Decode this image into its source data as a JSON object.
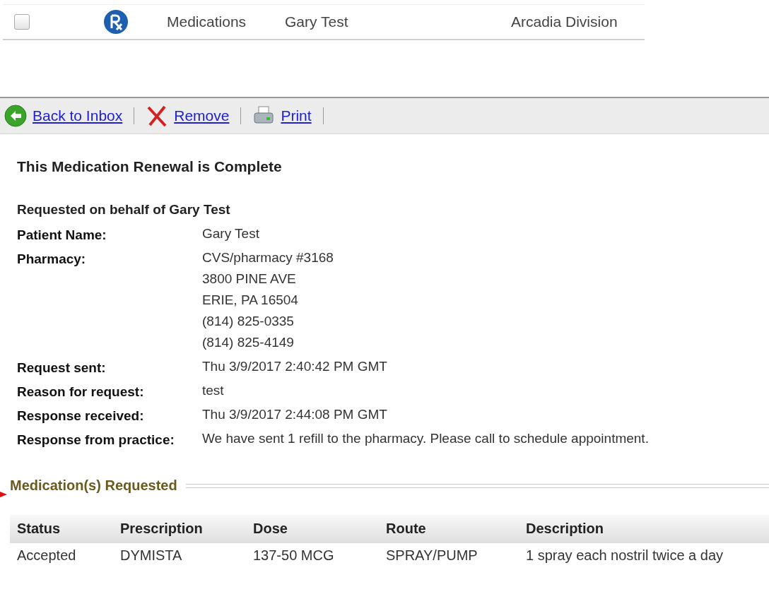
{
  "message_row": {
    "checked": false,
    "type": "Medications",
    "patient": "Gary Test",
    "division": "Arcadia Division"
  },
  "toolbar": [
    {
      "kind": "back",
      "label": "Back to Inbox"
    },
    {
      "kind": "remove",
      "label": "Remove"
    },
    {
      "kind": "print",
      "label": "Print"
    }
  ],
  "title": "This Medication Renewal is Complete",
  "subtitle": "Requested on behalf of Gary Test",
  "details": [
    {
      "label": "Patient Name:",
      "lines": [
        "Gary Test"
      ]
    },
    {
      "label": "Pharmacy:",
      "lines": [
        "CVS/pharmacy #3168",
        "3800 PINE AVE",
        "ERIE, PA 16504",
        "(814) 825-0335",
        "(814) 825-4149"
      ]
    },
    {
      "label": "Request sent:",
      "lines": [
        "Thu 3/9/2017 2:40:42 PM GMT"
      ]
    },
    {
      "label": "Reason for request:",
      "lines": [
        "test"
      ]
    },
    {
      "label": "Response received:",
      "lines": [
        "Thu 3/9/2017 2:44:08 PM GMT"
      ]
    },
    {
      "label": "Response from practice:",
      "lines": [
        "We have sent 1 refill to the pharmacy. Please call to schedule appointment."
      ]
    }
  ],
  "section_title": "Medication(s) Requested",
  "table": {
    "columns": [
      "Status",
      "Prescription",
      "Dose",
      "Route",
      "Description"
    ],
    "rows": [
      [
        "Accepted",
        "DYMISTA",
        "137-50 MCG",
        "SPRAY/PUMP",
        "1 spray each nostril twice a day"
      ]
    ]
  }
}
